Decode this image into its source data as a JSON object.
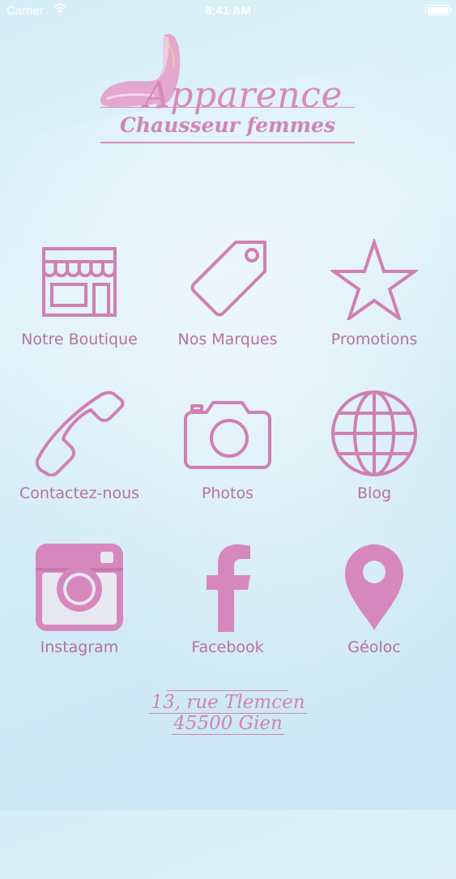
{
  "status_bar": {
    "carrier": "Carrier",
    "time": "8:41 AM"
  },
  "logo": {
    "brand": "Apparence",
    "tagline": "Chausseur femmes"
  },
  "colors": {
    "accent": "#d78ab9",
    "icon_stroke": "#d07fb3",
    "label": "#b771a0"
  },
  "menu": [
    {
      "label": "Notre Boutique",
      "icon": "storefront-icon"
    },
    {
      "label": "Nos Marques",
      "icon": "price-tag-icon"
    },
    {
      "label": "Promotions",
      "icon": "star-icon"
    },
    {
      "label": "Contactez-nous",
      "icon": "phone-icon"
    },
    {
      "label": "Photos",
      "icon": "camera-icon"
    },
    {
      "label": "Blog",
      "icon": "globe-icon"
    },
    {
      "label": "Instagram",
      "icon": "instagram-icon"
    },
    {
      "label": "Facebook",
      "icon": "facebook-icon"
    },
    {
      "label": "Géoloc",
      "icon": "map-pin-icon"
    }
  ],
  "address": {
    "line1": "13, rue Tlemcen",
    "line2": "45500 Gien"
  }
}
